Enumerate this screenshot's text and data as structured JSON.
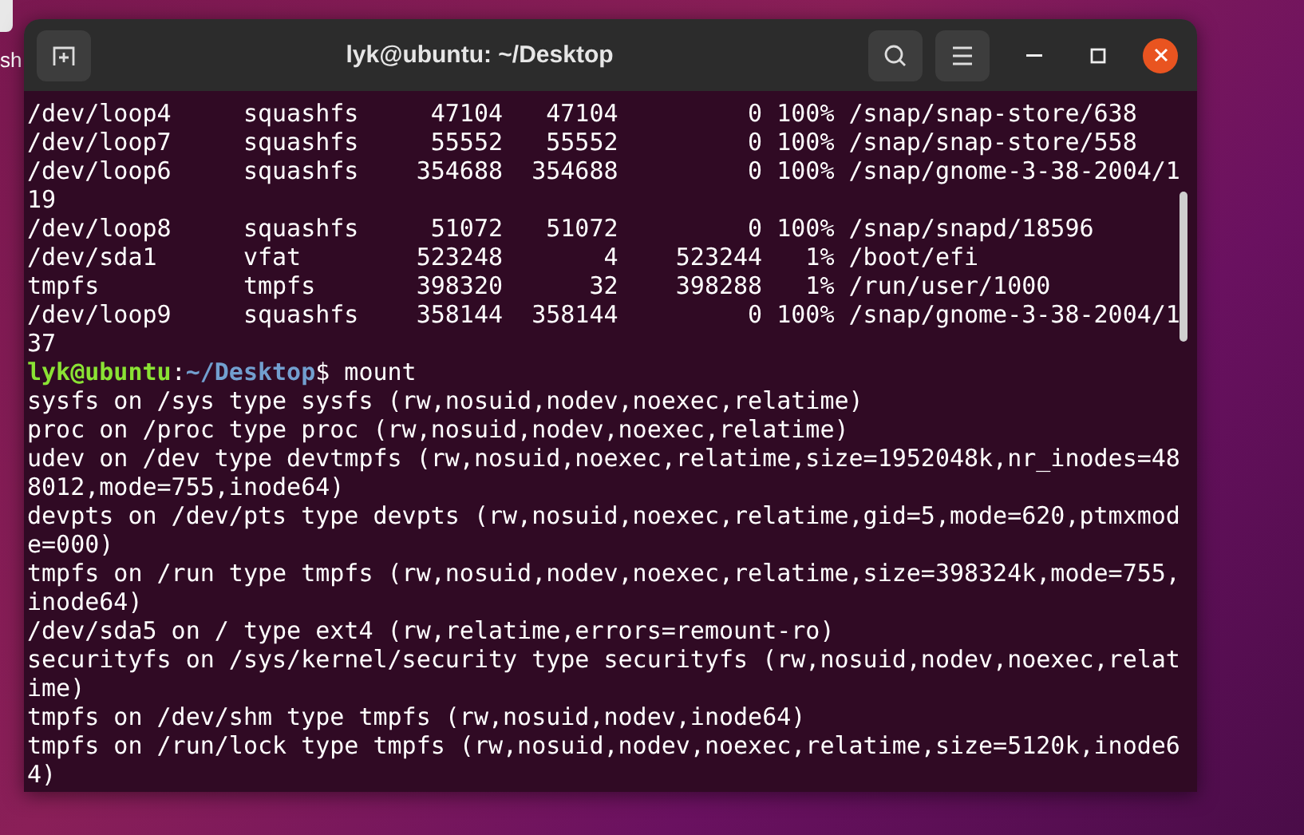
{
  "desktop": {
    "icon_label": "sh"
  },
  "window": {
    "title": "lyk@ubuntu: ~/Desktop"
  },
  "terminal": {
    "lines": [
      {
        "kind": "output",
        "text": "/dev/loop4     squashfs     47104   47104         0 100% /snap/snap-store/638"
      },
      {
        "kind": "output",
        "text": "/dev/loop7     squashfs     55552   55552         0 100% /snap/snap-store/558"
      },
      {
        "kind": "output",
        "text": "/dev/loop6     squashfs    354688  354688         0 100% /snap/gnome-3-38-2004/1"
      },
      {
        "kind": "output",
        "text": "19"
      },
      {
        "kind": "output",
        "text": "/dev/loop8     squashfs     51072   51072         0 100% /snap/snapd/18596"
      },
      {
        "kind": "output",
        "text": "/dev/sda1      vfat        523248       4    523244   1% /boot/efi"
      },
      {
        "kind": "output",
        "text": "tmpfs          tmpfs       398320      32    398288   1% /run/user/1000"
      },
      {
        "kind": "output",
        "text": "/dev/loop9     squashfs    358144  358144         0 100% /snap/gnome-3-38-2004/1"
      },
      {
        "kind": "output",
        "text": "37"
      },
      {
        "kind": "prompt",
        "user": "lyk@ubuntu",
        "separator": ":",
        "path": "~/Desktop",
        "command": "$ mount"
      },
      {
        "kind": "output",
        "text": "sysfs on /sys type sysfs (rw,nosuid,nodev,noexec,relatime)"
      },
      {
        "kind": "output",
        "text": "proc on /proc type proc (rw,nosuid,nodev,noexec,relatime)"
      },
      {
        "kind": "output",
        "text": "udev on /dev type devtmpfs (rw,nosuid,noexec,relatime,size=1952048k,nr_inodes=48"
      },
      {
        "kind": "output",
        "text": "8012,mode=755,inode64)"
      },
      {
        "kind": "output",
        "text": "devpts on /dev/pts type devpts (rw,nosuid,noexec,relatime,gid=5,mode=620,ptmxmod"
      },
      {
        "kind": "output",
        "text": "e=000)"
      },
      {
        "kind": "output",
        "text": "tmpfs on /run type tmpfs (rw,nosuid,nodev,noexec,relatime,size=398324k,mode=755,"
      },
      {
        "kind": "output",
        "text": "inode64)"
      },
      {
        "kind": "output",
        "text": "/dev/sda5 on / type ext4 (rw,relatime,errors=remount-ro)"
      },
      {
        "kind": "output",
        "text": "securityfs on /sys/kernel/security type securityfs (rw,nosuid,nodev,noexec,relat"
      },
      {
        "kind": "output",
        "text": "ime)"
      },
      {
        "kind": "output",
        "text": "tmpfs on /dev/shm type tmpfs (rw,nosuid,nodev,inode64)"
      },
      {
        "kind": "output",
        "text": "tmpfs on /run/lock type tmpfs (rw,nosuid,nodev,noexec,relatime,size=5120k,inode6"
      },
      {
        "kind": "output",
        "text": "4)"
      }
    ]
  }
}
